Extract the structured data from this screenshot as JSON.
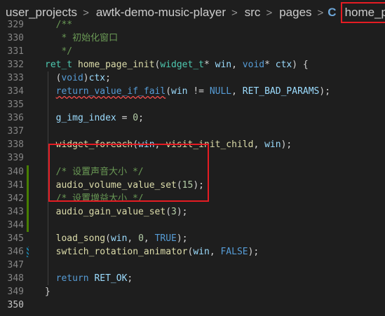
{
  "breadcrumb": {
    "items": [
      "user_projects",
      "awtk-demo-music-player",
      "src",
      "pages"
    ],
    "file_icon": "C",
    "file_name": "home_page.c",
    "separator": ">",
    "trailing": ">"
  },
  "editor": {
    "lines": [
      {
        "num": "329",
        "tokens": [
          {
            "t": "  /**",
            "c": "cmt"
          }
        ]
      },
      {
        "num": "330",
        "tokens": [
          {
            "t": "   * 初始化窗口",
            "c": "cmt"
          }
        ]
      },
      {
        "num": "331",
        "tokens": [
          {
            "t": "   */",
            "c": "cmt"
          }
        ]
      },
      {
        "num": "332",
        "tokens": [
          {
            "t": "ret_t",
            "c": "ty"
          },
          {
            "t": " "
          },
          {
            "t": "home_page_init",
            "c": "fn"
          },
          {
            "t": "("
          },
          {
            "t": "widget_t",
            "c": "ty"
          },
          {
            "t": "* "
          },
          {
            "t": "win",
            "c": "var"
          },
          {
            "t": ", "
          },
          {
            "t": "void",
            "c": "kw"
          },
          {
            "t": "* "
          },
          {
            "t": "ctx",
            "c": "var"
          },
          {
            "t": ") {"
          }
        ]
      },
      {
        "num": "333",
        "tokens": [
          {
            "t": "  ("
          },
          {
            "t": "void",
            "c": "kw"
          },
          {
            "t": ")"
          },
          {
            "t": "ctx",
            "c": "var"
          },
          {
            "t": ";"
          }
        ]
      },
      {
        "num": "334",
        "tokens": [
          {
            "t": "  "
          },
          {
            "t": "return_value_if_fail",
            "c": "mac",
            "sq": true
          },
          {
            "t": "("
          },
          {
            "t": "win",
            "c": "var"
          },
          {
            "t": " != "
          },
          {
            "t": "NULL",
            "c": "mac"
          },
          {
            "t": ", "
          },
          {
            "t": "RET_BAD_PARAMS",
            "c": "var"
          },
          {
            "t": ");"
          }
        ]
      },
      {
        "num": "335",
        "tokens": []
      },
      {
        "num": "336",
        "tokens": [
          {
            "t": "  "
          },
          {
            "t": "g_img_index",
            "c": "var"
          },
          {
            "t": " = "
          },
          {
            "t": "0",
            "c": "num"
          },
          {
            "t": ";"
          }
        ]
      },
      {
        "num": "337",
        "tokens": []
      },
      {
        "num": "338",
        "tokens": [
          {
            "t": "  "
          },
          {
            "t": "widget_foreach",
            "c": "fn"
          },
          {
            "t": "("
          },
          {
            "t": "win",
            "c": "var"
          },
          {
            "t": ", "
          },
          {
            "t": "visit_init_child",
            "c": "fn"
          },
          {
            "t": ", "
          },
          {
            "t": "win",
            "c": "var"
          },
          {
            "t": ");"
          }
        ]
      },
      {
        "num": "339",
        "tokens": []
      },
      {
        "num": "340",
        "mod": true,
        "tokens": [
          {
            "t": "  /* 设置声音大小 */",
            "c": "cmt"
          }
        ]
      },
      {
        "num": "341",
        "mod": true,
        "tokens": [
          {
            "t": "  "
          },
          {
            "t": "audio_volume_value_set",
            "c": "fn"
          },
          {
            "t": "("
          },
          {
            "t": "15",
            "c": "num"
          },
          {
            "t": ");"
          }
        ]
      },
      {
        "num": "342",
        "mod": true,
        "tokens": [
          {
            "t": "  /* 设置增益大小 */",
            "c": "cmt"
          }
        ]
      },
      {
        "num": "343",
        "mod": true,
        "tokens": [
          {
            "t": "  "
          },
          {
            "t": "audio_gain_value_set",
            "c": "fn"
          },
          {
            "t": "("
          },
          {
            "t": "3",
            "c": "num"
          },
          {
            "t": ");"
          }
        ]
      },
      {
        "num": "344",
        "mod": true,
        "tokens": []
      },
      {
        "num": "345",
        "tokens": [
          {
            "t": "  "
          },
          {
            "t": "load_song",
            "c": "fn"
          },
          {
            "t": "("
          },
          {
            "t": "win",
            "c": "var"
          },
          {
            "t": ", "
          },
          {
            "t": "0",
            "c": "num"
          },
          {
            "t": ", "
          },
          {
            "t": "TRUE",
            "c": "mac"
          },
          {
            "t": ");"
          }
        ]
      },
      {
        "num": "346",
        "edit": true,
        "tokens": [
          {
            "t": "  "
          },
          {
            "t": "swtich_rotation_animator",
            "c": "fn"
          },
          {
            "t": "("
          },
          {
            "t": "win",
            "c": "var"
          },
          {
            "t": ", "
          },
          {
            "t": "FALSE",
            "c": "mac"
          },
          {
            "t": ");"
          }
        ]
      },
      {
        "num": "347",
        "tokens": []
      },
      {
        "num": "348",
        "tokens": [
          {
            "t": "  "
          },
          {
            "t": "return",
            "c": "kw"
          },
          {
            "t": " "
          },
          {
            "t": "RET_OK",
            "c": "var"
          },
          {
            "t": ";"
          }
        ]
      },
      {
        "num": "349",
        "tokens": [
          {
            "t": "}"
          }
        ]
      },
      {
        "num": "350",
        "cur": true,
        "tokens": []
      }
    ]
  },
  "colors": {
    "background": "#1e1e1e",
    "annotation_box": "#e51c23",
    "modified_gutter": "#487e02"
  }
}
